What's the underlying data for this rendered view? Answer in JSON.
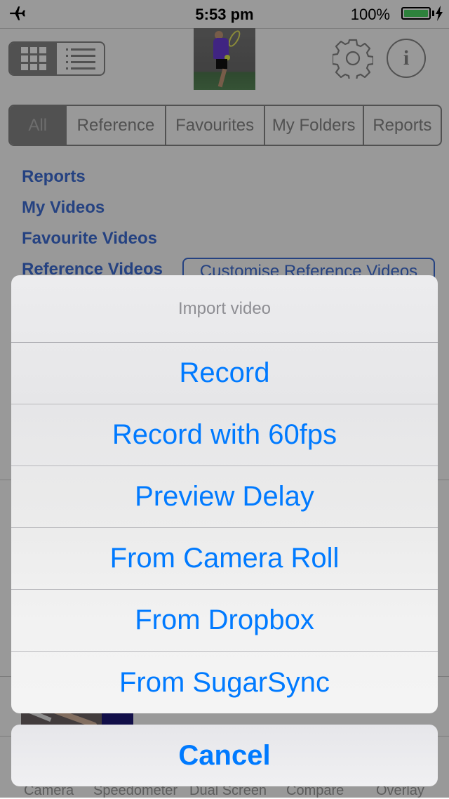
{
  "status_bar": {
    "time": "5:53 pm",
    "battery_percent": "100%",
    "icons": [
      "airplane-mode-icon",
      "battery-icon",
      "charging-bolt-icon"
    ]
  },
  "toolbar": {
    "view_modes": [
      "grid-view",
      "list-view"
    ],
    "active_view": "grid-view",
    "icons": [
      "grid-icon",
      "list-icon",
      "gear-icon",
      "info-icon"
    ],
    "info_glyph": "i"
  },
  "filter_tabs": [
    {
      "label": "All",
      "selected": true
    },
    {
      "label": "Reference",
      "selected": false
    },
    {
      "label": "Favourites",
      "selected": false
    },
    {
      "label": "My Folders",
      "selected": false
    },
    {
      "label": "Reports",
      "selected": false
    }
  ],
  "links": [
    "Reports",
    "My Videos",
    "Favourite Videos",
    "Reference Videos"
  ],
  "customise_button": "Customise Reference Videos",
  "bottom_tabs": [
    "Camera",
    "Speedometer",
    "Dual Screen",
    "Compare",
    "Overlay"
  ],
  "action_sheet": {
    "title": "Import video",
    "options": [
      "Record",
      "Record with 60fps",
      "Preview Delay",
      "From Camera Roll",
      "From Dropbox",
      "From SugarSync"
    ],
    "cancel": "Cancel"
  },
  "colors": {
    "action_blue": "#007aff",
    "link_blue": "#3f6fd8",
    "battery_green": "#4cd964"
  }
}
